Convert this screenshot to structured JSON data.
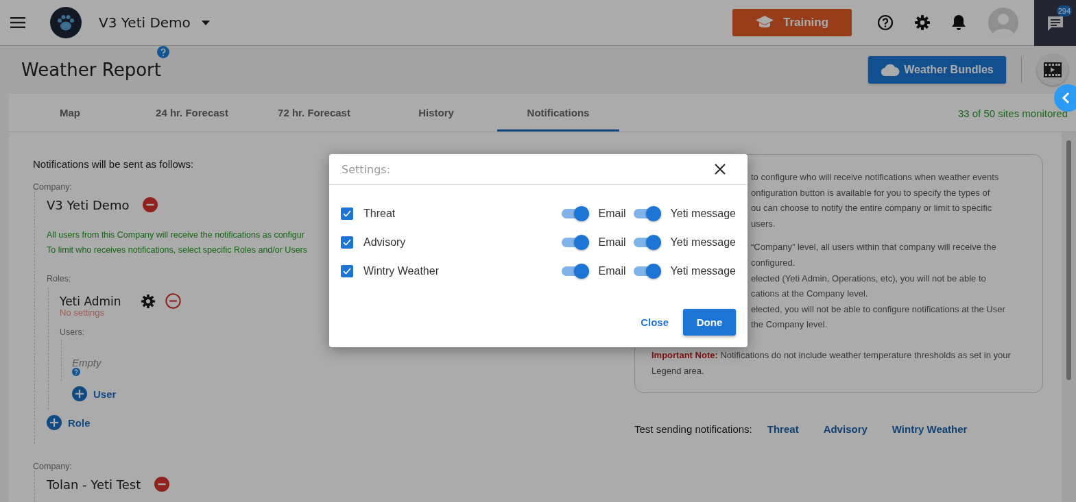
{
  "top_bar": {
    "company": "V3 Yeti Demo",
    "training_button": "Training",
    "chat_badge": "294"
  },
  "page": {
    "title": "Weather Report",
    "primary_button": "Weather Bundles"
  },
  "tabs": [
    {
      "label": "Map",
      "selected": false
    },
    {
      "label": "24 hr. Forecast",
      "selected": false
    },
    {
      "label": "72 hr. Forecast",
      "selected": false
    },
    {
      "label": "History",
      "selected": false
    },
    {
      "label": "Notifications",
      "selected": true
    }
  ],
  "sites_monitored": "33 of 50 sites monitored",
  "notifications": {
    "heading": "Notifications will be sent as follows:",
    "companies": [
      {
        "label": "Company:",
        "name": "V3 Yeti Demo",
        "messages": [
          "All users from this Company will receive the notifications as configur",
          "To limit who receives notifications, select specific Roles and/or Users"
        ],
        "roles_label": "Roles:",
        "roles": [
          {
            "name": "Yeti Admin",
            "status": "No settings",
            "users_label": "Users:",
            "users_empty": "Empty",
            "add_user": "User"
          }
        ],
        "add_role": "Role"
      },
      {
        "label": "Company:",
        "name": "Tolan - Yeti Test"
      }
    ]
  },
  "info_box": {
    "paragraphs": [
      [
        "to configure who will receive notifications when weather events",
        "onfiguration button is available for you to specify the types of",
        "ou can choose to notify the entire company or limit to specific",
        "users."
      ],
      [
        "“Company” level, all users within that company will receive the",
        "configured.",
        "elected (Yeti Admin, Operations, etc), you will not be able to",
        "cations at the Company level.",
        "elected, you will not be able to configure notifications at the User",
        "the Company level."
      ]
    ],
    "note": "**Important Note:** Notifications do not include weather temperature thresholds as set in your Legend area."
  },
  "test_sending": {
    "label": "Test sending notifications:",
    "links": [
      "Threat",
      "Advisory",
      "Wintry Weather"
    ]
  },
  "dialog": {
    "title": "Settings:",
    "rows": [
      {
        "label": "Threat",
        "checked": true,
        "email": {
          "label": "Email",
          "on": true
        },
        "yeti_message": {
          "label": "Yeti message",
          "on": true
        }
      },
      {
        "label": "Advisory",
        "checked": true,
        "email": {
          "label": "Email",
          "on": true
        },
        "yeti_message": {
          "label": "Yeti message",
          "on": true
        }
      },
      {
        "label": "Wintry Weather",
        "checked": true,
        "email": {
          "label": "Email",
          "on": true
        },
        "yeti_message": {
          "label": "Yeti message",
          "on": true
        }
      }
    ],
    "close": "Close",
    "done": "Done"
  }
}
